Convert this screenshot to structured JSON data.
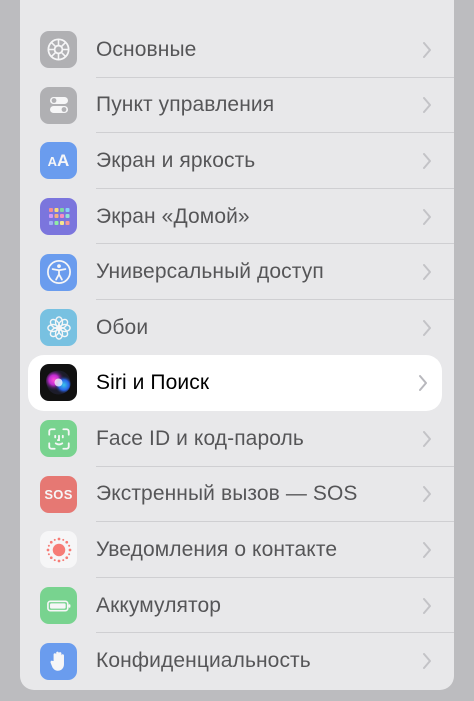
{
  "settings": {
    "items": [
      {
        "label": "Основные",
        "icon": "gear-icon",
        "color": "#8e8e93"
      },
      {
        "label": "Пункт управления",
        "icon": "toggles-icon",
        "color": "#8e8e93"
      },
      {
        "label": "Экран и яркость",
        "icon": "text-size-icon",
        "color": "#1e6ff1"
      },
      {
        "label": "Экран «Домой»",
        "icon": "home-grid-icon",
        "color": "#3a2fd6"
      },
      {
        "label": "Универсальный доступ",
        "icon": "accessibility-icon",
        "color": "#1e6ff1"
      },
      {
        "label": "Обои",
        "icon": "flower-icon",
        "color": "#34aadc"
      },
      {
        "label": "Siri и Поиск",
        "icon": "siri-icon",
        "color": "#111111"
      },
      {
        "label": "Face ID и код-пароль",
        "icon": "face-id-icon",
        "color": "#34c759"
      },
      {
        "label": "Экстренный вызов — SOS",
        "icon": "sos-icon",
        "color": "#e5342b",
        "badge": "SOS"
      },
      {
        "label": "Уведомления о контакте",
        "icon": "exposure-icon",
        "color": "#ffffff"
      },
      {
        "label": "Аккумулятор",
        "icon": "battery-icon",
        "color": "#34c759"
      },
      {
        "label": "Конфиденциальность",
        "icon": "hand-icon",
        "color": "#1e6ff1"
      }
    ],
    "highlighted": "Siri и Поиск"
  }
}
